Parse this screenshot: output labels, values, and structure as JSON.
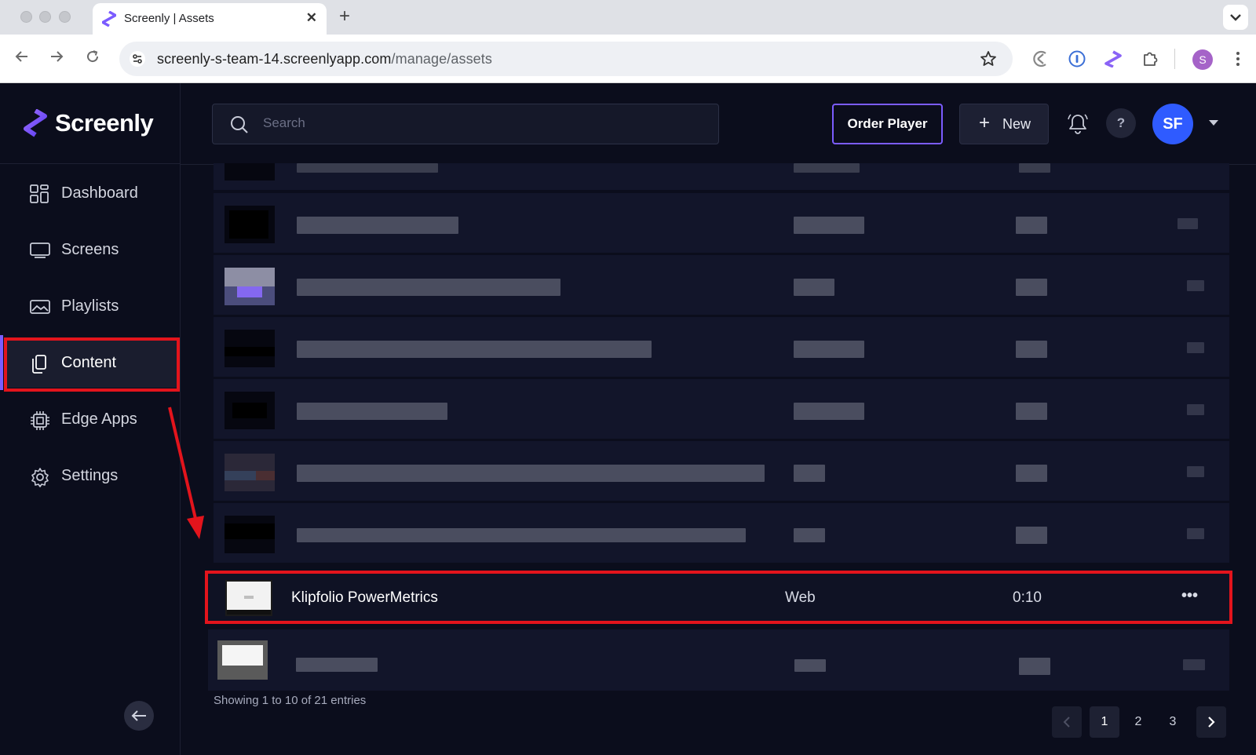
{
  "browser": {
    "tab_title": "Screenly | Assets",
    "url_host": "screenly-s-team-14.screenlyapp.com",
    "url_path": "/manage/assets",
    "profile_initial": "S"
  },
  "app": {
    "brand": "Screenly",
    "nav": [
      {
        "label": "Dashboard",
        "icon": "dashboard-icon"
      },
      {
        "label": "Screens",
        "icon": "monitor-icon"
      },
      {
        "label": "Playlists",
        "icon": "image-icon"
      },
      {
        "label": "Content",
        "icon": "copy-icon",
        "active": true
      },
      {
        "label": "Edge Apps",
        "icon": "chip-icon"
      },
      {
        "label": "Settings",
        "icon": "gear-icon"
      }
    ],
    "search_placeholder": "Search",
    "order_player_label": "Order Player",
    "new_label": "New",
    "help_label": "?",
    "avatar_initials": "SF"
  },
  "assets": {
    "highlighted_row": {
      "name": "Klipfolio PowerMetrics",
      "type": "Web",
      "duration": "0:10",
      "more": "•••"
    },
    "showing": "Showing 1 to 10 of 21 entries",
    "pages": [
      "1",
      "2",
      "3"
    ],
    "current_page": "1"
  },
  "colors": {
    "accent": "#7b5cff",
    "avatar": "#2f5bff",
    "highlight": "#e3141c"
  }
}
